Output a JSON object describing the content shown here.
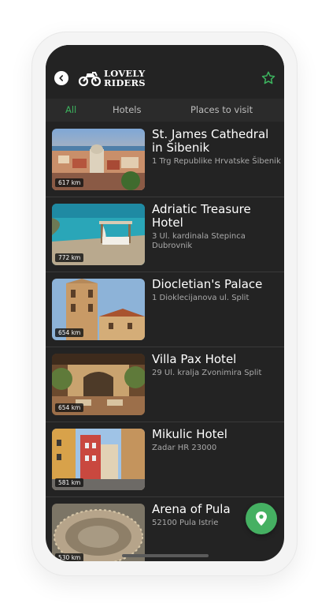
{
  "app": {
    "logo_line1": "LOVELY",
    "logo_line2": "RIDERS"
  },
  "tabs": [
    {
      "label": "All",
      "active": true
    },
    {
      "label": "Hotels",
      "active": false
    },
    {
      "label": "Places to visit",
      "active": false
    }
  ],
  "places": [
    {
      "title": "St. James Cathedral in Šibenik",
      "address": "1 Trg Republike Hrvatske Šibenik",
      "distance": "617 km"
    },
    {
      "title": "Adriatic Treasure Hotel",
      "address": "3 Ul. kardinala Stepinca Dubrovnik",
      "distance": "772 km"
    },
    {
      "title": "Diocletian's Palace",
      "address": "1 Dioklecijanova ul. Split",
      "distance": "654 km"
    },
    {
      "title": "Villa Pax Hotel",
      "address": "29 Ul. kralja Zvonimira Split",
      "distance": "654 km"
    },
    {
      "title": "Mikulic Hotel",
      "address": "Zadar HR 23000",
      "distance": "581 km"
    },
    {
      "title": "Arena of Pula",
      "address": "52100 Pula Istrie",
      "distance": "530 km"
    }
  ],
  "colors": {
    "accent": "#3cb35e",
    "background": "#232323",
    "tab_bar": "#2b2b2b"
  },
  "icons": {
    "back": "chevron-left-icon",
    "favorite": "star-icon",
    "map": "location-pin-icon",
    "logo": "motorcycle-icon"
  }
}
